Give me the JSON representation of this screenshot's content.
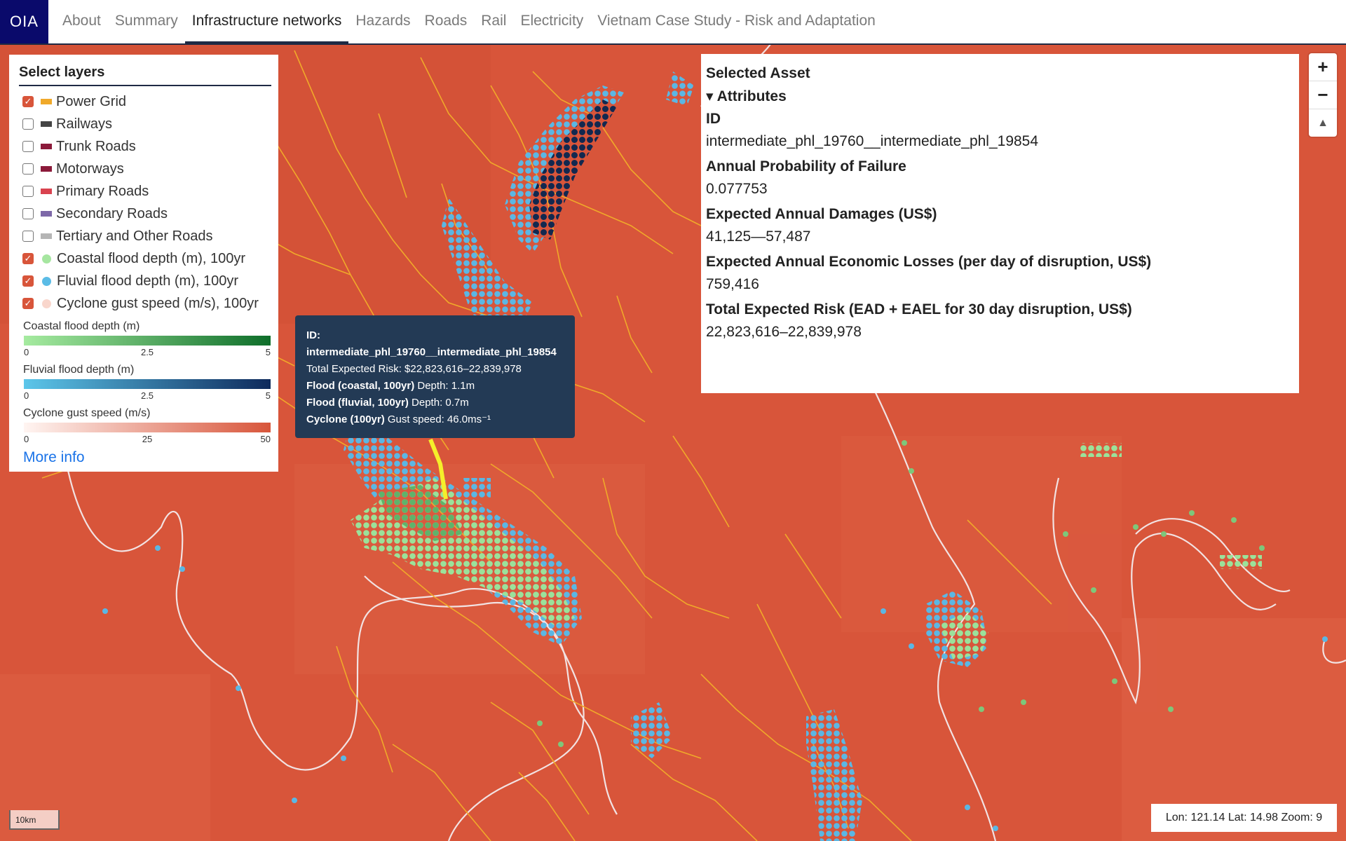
{
  "header": {
    "logo": "OIA",
    "nav": [
      {
        "label": "About",
        "active": false
      },
      {
        "label": "Summary",
        "active": false
      },
      {
        "label": "Infrastructure networks",
        "active": true
      },
      {
        "label": "Hazards",
        "active": false
      },
      {
        "label": "Roads",
        "active": false
      },
      {
        "label": "Rail",
        "active": false
      },
      {
        "label": "Electricity",
        "active": false
      },
      {
        "label": "Vietnam Case Study - Risk and Adaptation",
        "active": false
      }
    ]
  },
  "layers_panel": {
    "title": "Select layers",
    "layers": [
      {
        "label": "Power Grid",
        "checked": true,
        "swatch": "rect",
        "color": "#f0a92a"
      },
      {
        "label": "Railways",
        "checked": false,
        "swatch": "rect",
        "color": "#444444"
      },
      {
        "label": "Trunk Roads",
        "checked": false,
        "swatch": "rect",
        "color": "#8b1a3a"
      },
      {
        "label": "Motorways",
        "checked": false,
        "swatch": "rect",
        "color": "#8b1a3a"
      },
      {
        "label": "Primary Roads",
        "checked": false,
        "swatch": "rect",
        "color": "#d9434f"
      },
      {
        "label": "Secondary Roads",
        "checked": false,
        "swatch": "rect",
        "color": "#7d68a8"
      },
      {
        "label": "Tertiary and Other Roads",
        "checked": false,
        "swatch": "rect",
        "color": "#b5b5b5"
      },
      {
        "label": "Coastal flood depth (m), 100yr",
        "checked": true,
        "swatch": "dot",
        "color": "#a6e6a0"
      },
      {
        "label": "Fluvial flood depth (m), 100yr",
        "checked": true,
        "swatch": "dot",
        "color": "#5bbce6"
      },
      {
        "label": "Cyclone gust speed (m/s), 100yr",
        "checked": true,
        "swatch": "dot",
        "color": "#f9d6cc"
      }
    ],
    "legends": [
      {
        "title": "Coastal flood depth (m)",
        "ticks": [
          "0",
          "2.5",
          "5"
        ],
        "from": "#a6eba0",
        "to": "#0e6e2a"
      },
      {
        "title": "Fluvial flood depth (m)",
        "ticks": [
          "0",
          "2.5",
          "5"
        ],
        "from": "#5cc6ea",
        "to": "#0e2a5c"
      },
      {
        "title": "Cyclone gust speed (m/s)",
        "ticks": [
          "0",
          "25",
          "50"
        ],
        "from": "#fff5f2",
        "to": "#d8553a"
      }
    ],
    "more_info": "More info"
  },
  "tooltip": {
    "id_label": "ID:",
    "id_value": "intermediate_phl_19760__intermediate_phl_19854",
    "risk_text": "Total Expected Risk: $22,823,616–22,839,978",
    "coastal_label": "Flood (coastal, 100yr)",
    "coastal_value": " Depth: 1.1m",
    "fluvial_label": "Flood (fluvial, 100yr)",
    "fluvial_value": " Depth: 0.7m",
    "cyclone_label": "Cyclone (100yr)",
    "cyclone_value": " Gust speed: 46.0ms⁻¹"
  },
  "asset_panel": {
    "title": "Selected Asset",
    "attributes_toggle": "▾ Attributes",
    "attributes": [
      {
        "key": "ID",
        "value": "intermediate_phl_19760__intermediate_phl_19854"
      },
      {
        "key": "Annual Probability of Failure",
        "value": "0.077753"
      },
      {
        "key": "Expected Annual Damages (US$)",
        "value": "41,125—57,487"
      },
      {
        "key": "Expected Annual Economic Losses (per day of disruption, US$)",
        "value": "759,416"
      },
      {
        "key": "Total Expected Risk (EAD + EAEL for 30 day disruption, US$)",
        "value": "22,823,616–22,839,978"
      }
    ]
  },
  "map_controls": {
    "zoom_in": "+",
    "zoom_out": "−",
    "compass": "▲"
  },
  "scale_bar": "10km",
  "coordinates": "Lon: 121.14 Lat: 14.98 Zoom: 9",
  "colors": {
    "map_background": "#d8553a",
    "power_grid": "#f0a92a",
    "coastline": "#f2e6e6",
    "header_accent": "#1f2a44",
    "logo_bg": "#0a0a6b",
    "link": "#1a73e8",
    "tooltip_bg": "#233a55",
    "selected_asset": "#f5ef2a"
  }
}
